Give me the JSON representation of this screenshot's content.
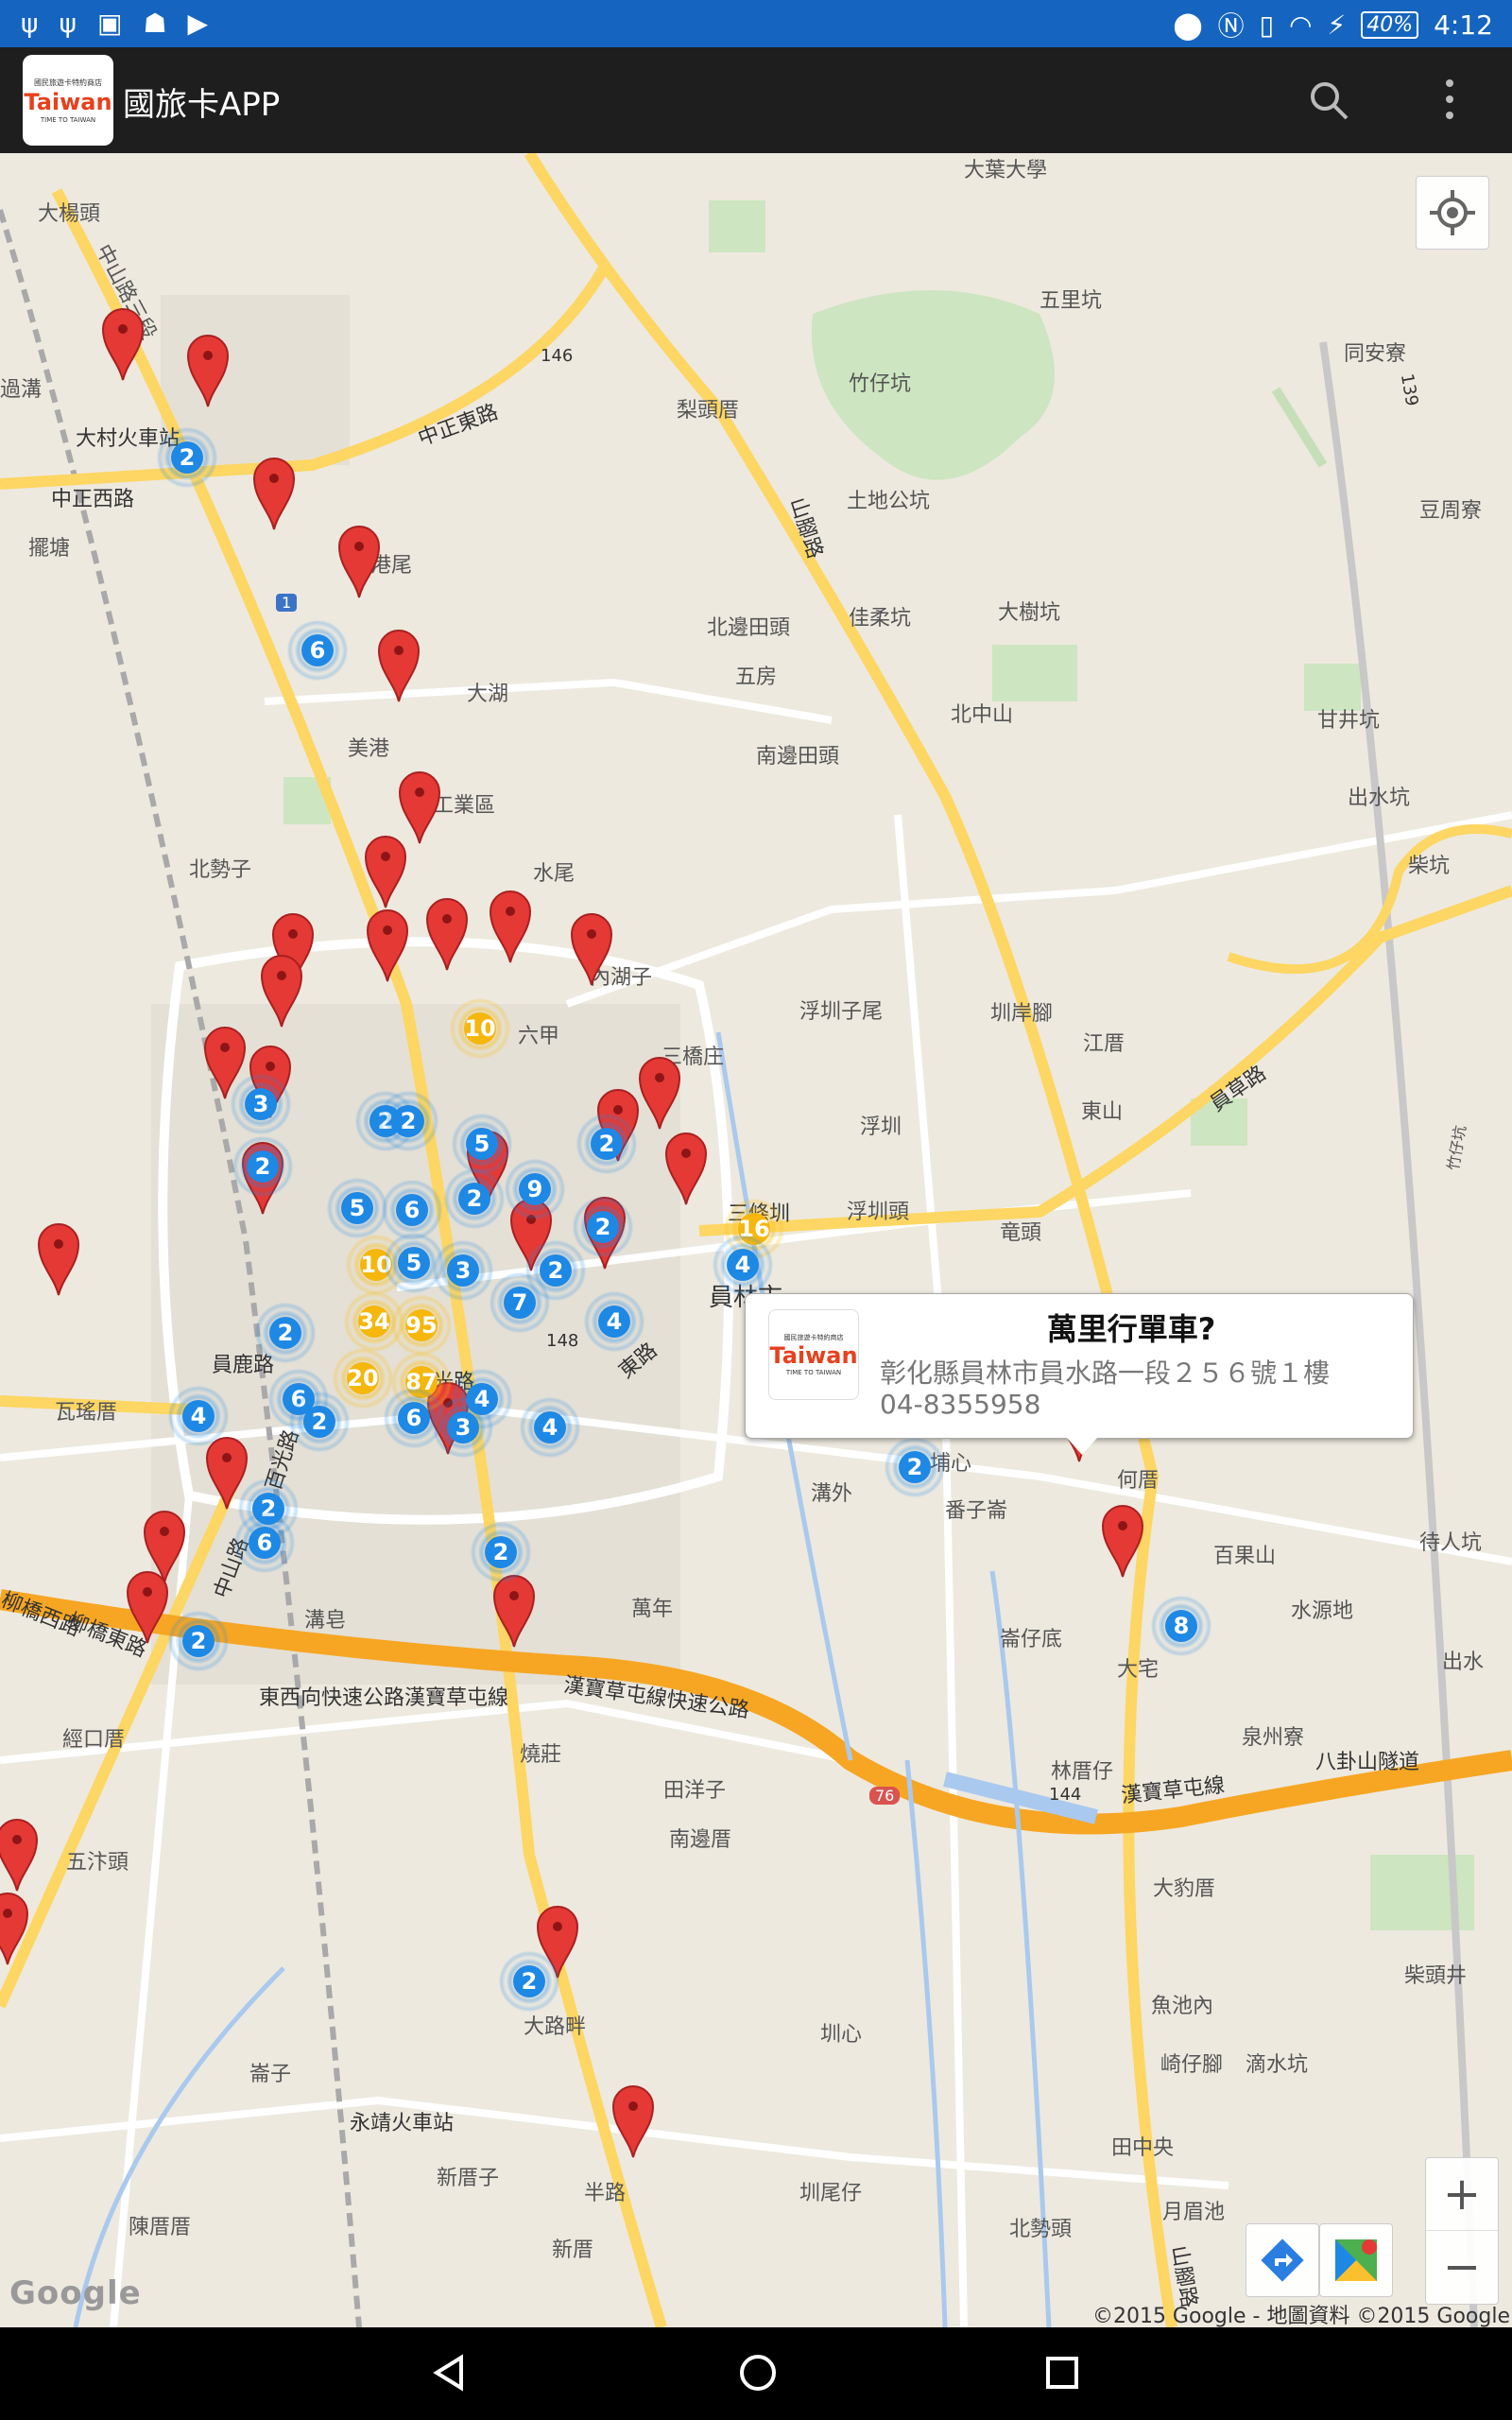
{
  "status_bar": {
    "battery": "40%",
    "time": "4:12"
  },
  "app_bar": {
    "title": "國旅卡APP",
    "logo": {
      "line1": "國民旅遊卡特約商店",
      "brand": "Taiwan",
      "line3": "TIME TO TAIWAN"
    }
  },
  "map": {
    "labels": [
      {
        "text": "大葉大學"
      },
      {
        "text": "大楊頭"
      },
      {
        "text": "中山路三段"
      },
      {
        "text": "過溝"
      },
      {
        "text": "大村火車站"
      },
      {
        "text": "中正東路"
      },
      {
        "text": "中正西路"
      },
      {
        "text": "擺塘"
      },
      {
        "text": "港尾"
      },
      {
        "text": "美港"
      },
      {
        "text": "大湖"
      },
      {
        "text": "山工業區"
      },
      {
        "text": "北勢子"
      },
      {
        "text": "水尾"
      },
      {
        "text": "梨頭厝"
      },
      {
        "text": "竹仔坑"
      },
      {
        "text": "土地公坑"
      },
      {
        "text": "山腳路"
      },
      {
        "text": "北邊田頭"
      },
      {
        "text": "五房"
      },
      {
        "text": "南邊田頭"
      },
      {
        "text": "佳柔坑"
      },
      {
        "text": "大樹坑"
      },
      {
        "text": "北中山"
      },
      {
        "text": "五里坑"
      },
      {
        "text": "同安寮"
      },
      {
        "text": "豆周寮"
      },
      {
        "text": "甘井坑"
      },
      {
        "text": "出水坑"
      },
      {
        "text": "柴坑"
      },
      {
        "text": "內湖子"
      },
      {
        "text": "六甲"
      },
      {
        "text": "三橋庄"
      },
      {
        "text": "浮圳子尾"
      },
      {
        "text": "圳岸腳"
      },
      {
        "text": "江厝"
      },
      {
        "text": "東山"
      },
      {
        "text": "員草路"
      },
      {
        "text": "浮圳"
      },
      {
        "text": "浮圳頭"
      },
      {
        "text": "竹仔坑"
      },
      {
        "text": "三條圳"
      },
      {
        "text": "員林市"
      },
      {
        "text": "竜頭"
      },
      {
        "text": "埔心"
      },
      {
        "text": "瓦瑤厝"
      },
      {
        "text": "員鹿路"
      },
      {
        "text": "東西向快速公路漢寶草屯線"
      },
      {
        "text": "漢寶草屯線快速公路"
      },
      {
        "text": "柳橋西路"
      },
      {
        "text": "柳橋東路"
      },
      {
        "text": "中山路"
      },
      {
        "text": "溝皂"
      },
      {
        "text": "萬年"
      },
      {
        "text": "溝外"
      },
      {
        "text": "番子崙"
      },
      {
        "text": "崙仔底"
      },
      {
        "text": "何厝"
      },
      {
        "text": "百果山"
      },
      {
        "text": "待人坑"
      },
      {
        "text": "水源地"
      },
      {
        "text": "出水"
      },
      {
        "text": "大宅"
      },
      {
        "text": "泉州寮"
      },
      {
        "text": "林厝仔"
      },
      {
        "text": "漢寶草屯線"
      },
      {
        "text": "八卦山隧道"
      },
      {
        "text": "田洋子"
      },
      {
        "text": "南邊厝"
      },
      {
        "text": "燒莊"
      },
      {
        "text": "經口厝"
      },
      {
        "text": "五汴頭"
      },
      {
        "text": "大豹厝"
      },
      {
        "text": "柴頭井"
      },
      {
        "text": "魚池內"
      },
      {
        "text": "崎仔腳"
      },
      {
        "text": "滴水坑"
      },
      {
        "text": "田中央"
      },
      {
        "text": "月眉池"
      },
      {
        "text": "北勢頭"
      },
      {
        "text": "圳尾仔"
      },
      {
        "text": "圳心"
      },
      {
        "text": "大路畔"
      },
      {
        "text": "崙子"
      },
      {
        "text": "永靖火車站"
      },
      {
        "text": "新厝子"
      },
      {
        "text": "陳厝厝"
      },
      {
        "text": "新厝"
      },
      {
        "text": "半路"
      },
      {
        "text": "山腳路"
      },
      {
        "text": "百光路"
      },
      {
        "text": "東路"
      },
      {
        "text": "光路"
      }
    ],
    "route_shields": [
      "146",
      "139",
      "1",
      "76",
      "144",
      "148"
    ],
    "clusters": [
      {
        "count": "2",
        "color": "blue"
      },
      {
        "count": "6",
        "color": "blue"
      },
      {
        "count": "2",
        "color": "blue"
      },
      {
        "count": "10",
        "color": "yellow"
      },
      {
        "count": "3",
        "color": "blue"
      },
      {
        "count": "2",
        "color": "blue"
      },
      {
        "count": "2",
        "color": "blue"
      },
      {
        "count": "5",
        "color": "blue"
      },
      {
        "count": "2",
        "color": "blue"
      },
      {
        "count": "9",
        "color": "blue"
      },
      {
        "count": "5",
        "color": "blue"
      },
      {
        "count": "6",
        "color": "blue"
      },
      {
        "count": "2",
        "color": "blue"
      },
      {
        "count": "2",
        "color": "blue"
      },
      {
        "count": "16",
        "color": "yellow"
      },
      {
        "count": "10",
        "color": "yellow"
      },
      {
        "count": "5",
        "color": "blue"
      },
      {
        "count": "3",
        "color": "blue"
      },
      {
        "count": "2",
        "color": "blue"
      },
      {
        "count": "4",
        "color": "blue"
      },
      {
        "count": "34",
        "color": "yellow"
      },
      {
        "count": "95",
        "color": "yellow"
      },
      {
        "count": "7",
        "color": "blue"
      },
      {
        "count": "4",
        "color": "blue"
      },
      {
        "count": "2",
        "color": "blue"
      },
      {
        "count": "20",
        "color": "yellow"
      },
      {
        "count": "87",
        "color": "yellow"
      },
      {
        "count": "6",
        "color": "blue"
      },
      {
        "count": "2",
        "color": "blue"
      },
      {
        "count": "4",
        "color": "blue"
      },
      {
        "count": "4",
        "color": "blue"
      },
      {
        "count": "6",
        "color": "blue"
      },
      {
        "count": "3",
        "color": "blue"
      },
      {
        "count": "4",
        "color": "blue"
      },
      {
        "count": "2",
        "color": "blue"
      },
      {
        "count": "6",
        "color": "blue"
      },
      {
        "count": "2",
        "color": "blue"
      },
      {
        "count": "2",
        "color": "blue"
      },
      {
        "count": "8",
        "color": "blue"
      },
      {
        "count": "2",
        "color": "blue"
      },
      {
        "count": "2",
        "color": "blue"
      }
    ],
    "info_window": {
      "name": "萬里行單車?",
      "address": "彰化縣員林市員水路一段２５６號１樓",
      "phone": "04-8355958"
    },
    "watermark": "Google",
    "copyright": "©2015 Google - 地圖資料 ©2015 Google"
  },
  "icons": {
    "search": "search-icon",
    "overflow": "more-vert-icon",
    "my_location": "my-location-icon",
    "zoom_in": "plus-icon",
    "zoom_out": "minus-icon",
    "directions": "directions-icon",
    "google_maps": "google-maps-icon",
    "back": "back-icon",
    "home": "home-icon",
    "recents": "recents-icon"
  },
  "colors": {
    "status_bar": "#1565c0",
    "app_bar": "#1e1e1e",
    "pin": "#e53935",
    "cluster_blue": "#1e88e5",
    "cluster_yellow": "#f5b70c",
    "highway": "#f6a623",
    "road": "#ffd54f"
  }
}
